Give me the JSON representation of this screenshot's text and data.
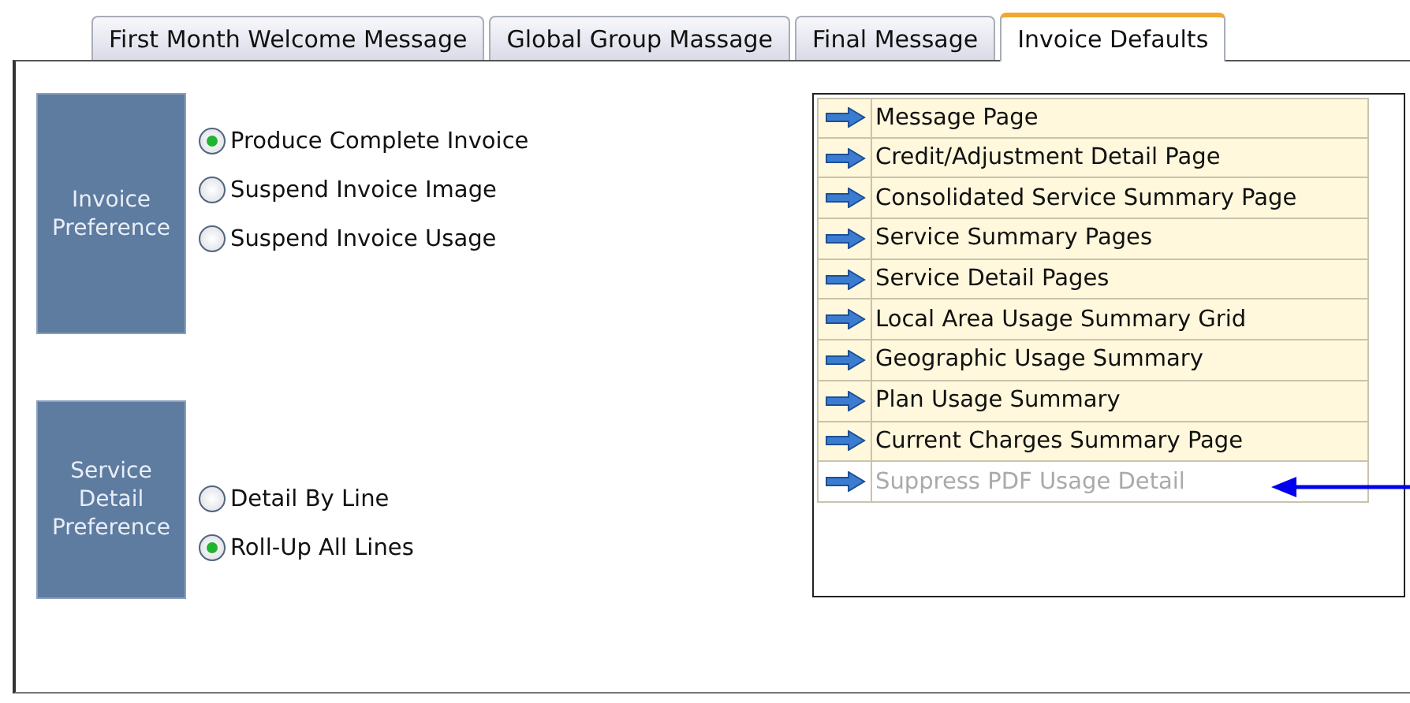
{
  "tabs": [
    {
      "label": "First Month Welcome Message",
      "selected": false
    },
    {
      "label": "Global Group Massage",
      "selected": false
    },
    {
      "label": "Final Message",
      "selected": false
    },
    {
      "label": "Invoice Defaults",
      "selected": true
    }
  ],
  "groups": [
    {
      "title": "Invoice Preference",
      "options": [
        {
          "label": "Produce Complete Invoice",
          "selected": true
        },
        {
          "label": "Suspend Invoice Image",
          "selected": false
        },
        {
          "label": "Suspend Invoice Usage",
          "selected": false
        }
      ]
    },
    {
      "title": "Service Detail Preference",
      "options": [
        {
          "label": "Detail By Line",
          "selected": false
        },
        {
          "label": "Roll-Up All Lines",
          "selected": true
        }
      ]
    }
  ],
  "pages": [
    {
      "label": "Message Page",
      "disabled": false
    },
    {
      "label": "Credit/Adjustment Detail Page",
      "disabled": false
    },
    {
      "label": "Consolidated Service Summary Page",
      "disabled": false
    },
    {
      "label": "Service Summary Pages",
      "disabled": false
    },
    {
      "label": "Service Detail Pages",
      "disabled": false
    },
    {
      "label": "Local Area Usage Summary Grid",
      "disabled": false
    },
    {
      "label": "Geographic Usage Summary",
      "disabled": false
    },
    {
      "label": "Plan Usage Summary",
      "disabled": false
    },
    {
      "label": "Current Charges Summary Page",
      "disabled": false
    },
    {
      "label": "Suppress PDF Usage Detail",
      "disabled": true
    }
  ]
}
